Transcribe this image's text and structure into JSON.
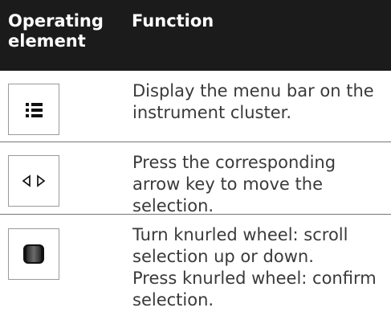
{
  "table": {
    "header": {
      "col1": "Operating element",
      "col2": "Function"
    },
    "rows": [
      {
        "icon": "menu-bars-icon",
        "descriptions": [
          "Display the menu bar on the instrument cluster."
        ]
      },
      {
        "icon": "arrow-keys-icon",
        "descriptions": [
          "Press the corresponding arrow key to move the selection."
        ]
      },
      {
        "icon": "knurled-wheel-icon",
        "descriptions": [
          "Turn knurled wheel: scroll selection up or down.",
          "Press knurled wheel: confirm selection."
        ]
      }
    ]
  }
}
